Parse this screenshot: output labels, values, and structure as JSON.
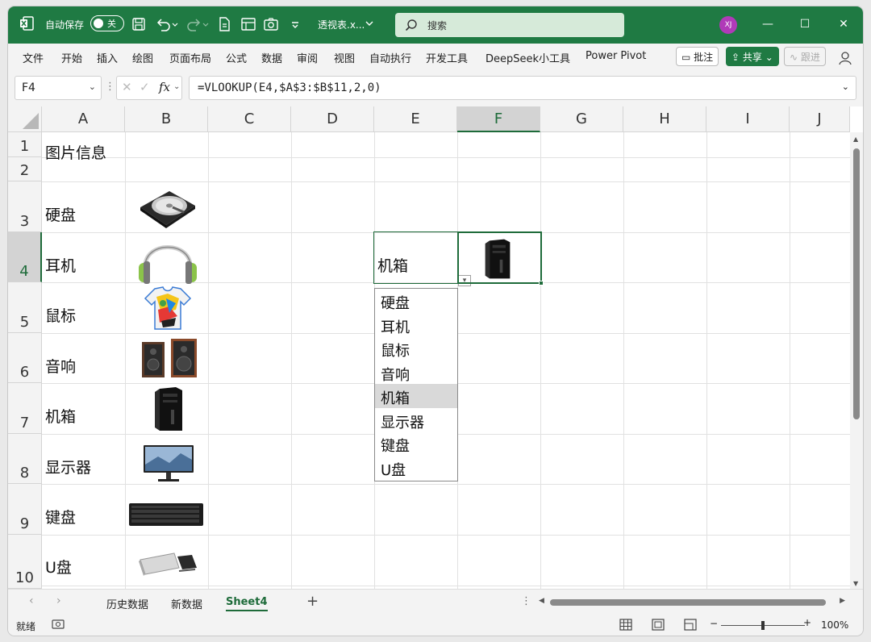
{
  "title_bar": {
    "autosave_label": "自动保存",
    "autosave_state": "关",
    "doc_title": "透视表.x...",
    "search_placeholder": "搜索",
    "avatar_initials": "XJ",
    "accent_color": "#1f7a43"
  },
  "ribbon": {
    "tabs": [
      "文件",
      "开始",
      "插入",
      "绘图",
      "页面布局",
      "公式",
      "数据",
      "审阅",
      "视图",
      "自动执行",
      "开发工具",
      "DeepSeek小工具",
      "Power Pivot"
    ],
    "comments_label": "批注",
    "share_label": "共享",
    "track_label": "跟进"
  },
  "formula_bar": {
    "name_box": "F4",
    "fx_label": "fx",
    "formula": "=VLOOKUP(E4,$A$3:$B$11,2,0)"
  },
  "grid": {
    "columns": [
      "A",
      "B",
      "C",
      "D",
      "E",
      "F",
      "G",
      "H",
      "I",
      "J"
    ],
    "rows": [
      "1",
      "2",
      "3",
      "4",
      "5",
      "6",
      "7",
      "8",
      "9",
      "10"
    ],
    "cells": {
      "A1": "图片信息",
      "A3": "硬盘",
      "A4": "耳机",
      "A5": "鼠标",
      "A6": "音响",
      "A7": "机箱",
      "A8": "显示器",
      "A9": "键盘",
      "A10": "U盘",
      "E4": "机箱"
    },
    "images_in_column_b": [
      "hard-disk-image",
      "headphones-image",
      "tshirt-image",
      "speakers-image",
      "pc-case-image",
      "monitor-image",
      "keyboard-image",
      "usb-drive-image"
    ],
    "f4_image": "pc-case-image"
  },
  "dropdown": {
    "items": [
      "硬盘",
      "耳机",
      "鼠标",
      "音响",
      "机箱",
      "显示器",
      "键盘",
      "U盘"
    ],
    "highlighted": "机箱"
  },
  "sheet_tabs": {
    "tabs": [
      "历史数据",
      "新数据",
      "Sheet4"
    ],
    "active": "Sheet4"
  },
  "status_bar": {
    "ready_label": "就绪",
    "zoom": "100%"
  }
}
